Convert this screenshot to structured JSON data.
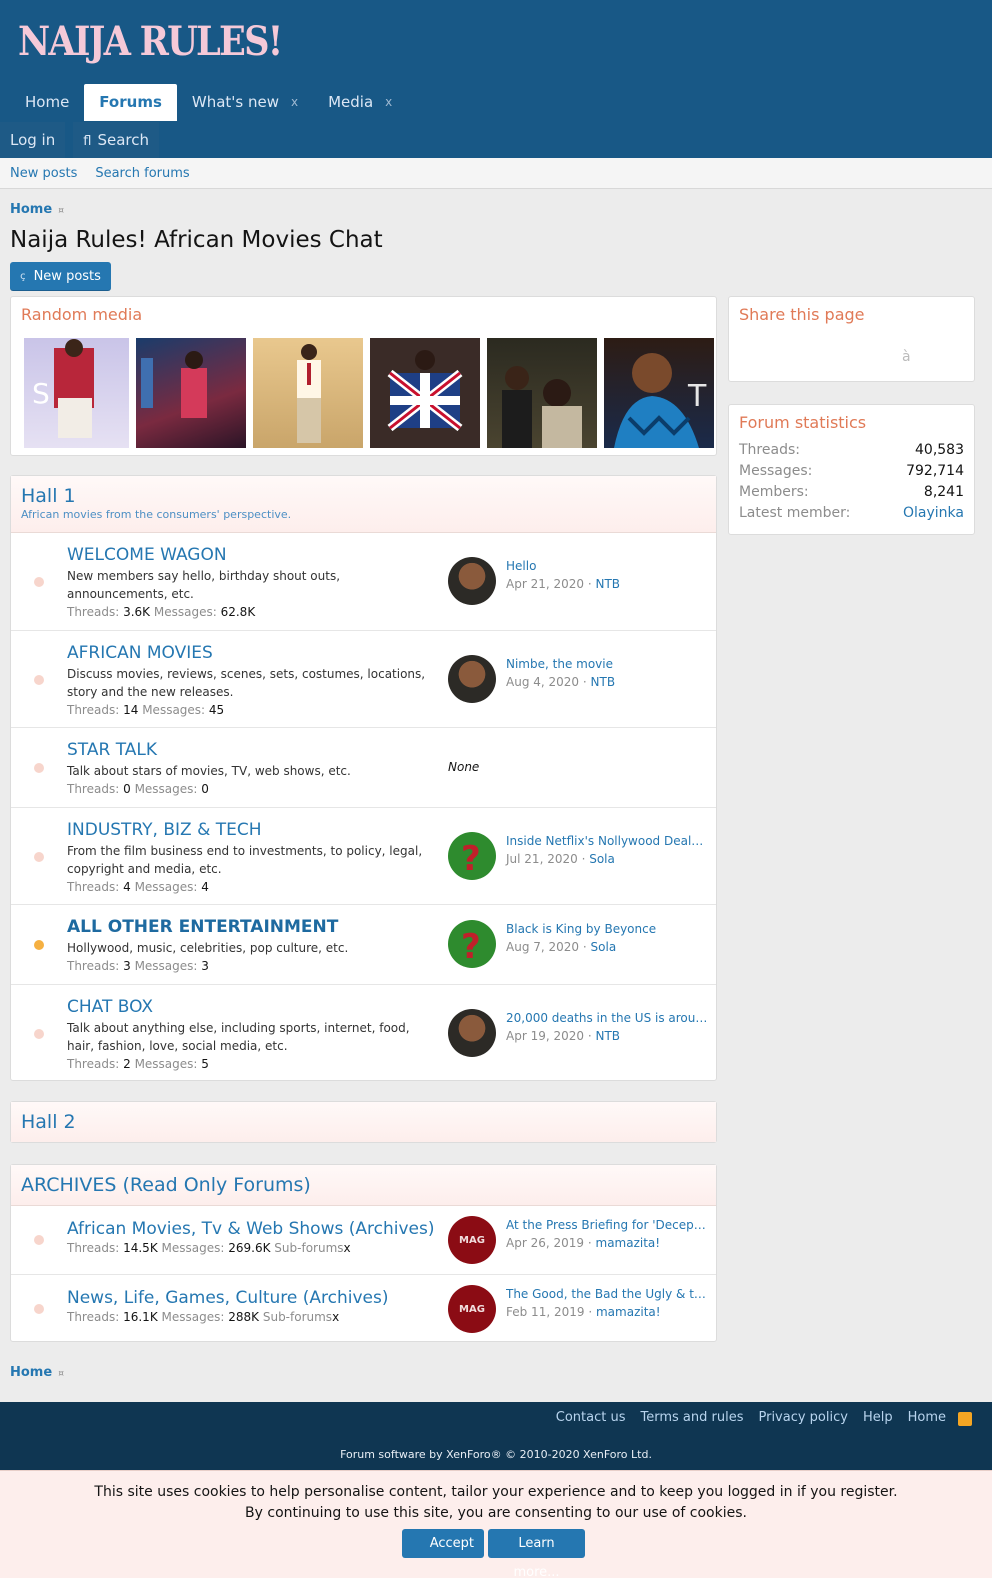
{
  "header": {
    "logo": "NAIJA RULES!",
    "nav": [
      {
        "label": "Home"
      },
      {
        "label": "Forums"
      },
      {
        "label": "What's new",
        "x": "x"
      },
      {
        "label": "Media",
        "x": "x"
      }
    ],
    "login_label": "Log in",
    "search_label": "Search",
    "search_glyph": "fl"
  },
  "subnav": {
    "new_posts": "New posts",
    "search_forums": "Search forums"
  },
  "breadcrumb": {
    "home": "Home",
    "sep": "¤"
  },
  "page": {
    "title": "Naija Rules! African Movies Chat",
    "new_posts_button": "New posts",
    "new_posts_glyph": "ç"
  },
  "random_media": {
    "title": "Random media"
  },
  "share": {
    "title": "Share this page",
    "glyph": "à"
  },
  "stats": {
    "title": "Forum statistics",
    "rows": [
      {
        "label": "Threads:",
        "value": "40,583"
      },
      {
        "label": "Messages:",
        "value": "792,714"
      },
      {
        "label": "Members:",
        "value": "8,241"
      },
      {
        "label": "Latest member:",
        "value": "Olayinka"
      }
    ]
  },
  "hall1": {
    "title": "Hall 1",
    "desc": "African movies from the consumers' perspective.",
    "nodes": [
      {
        "title": "WELCOME WAGON",
        "desc": "New members say hello, birthday shout outs, announcements, etc.",
        "threads": "3.6K",
        "messages": "62.8K",
        "last_title": "Hello",
        "last_date": "Apr 21, 2020",
        "last_user": "NTB"
      },
      {
        "title": "AFRICAN MOVIES",
        "desc": "Discuss movies, reviews, scenes, sets, costumes, locations, story and the new releases.",
        "threads": "14",
        "messages": "45",
        "last_title": "Nimbe, the movie",
        "last_date": "Aug 4, 2020",
        "last_user": "NTB"
      },
      {
        "title": "STAR TALK",
        "desc": "Talk about stars of movies, TV, web shows, etc.",
        "threads": "0",
        "messages": "0",
        "none": "None"
      },
      {
        "title": "INDUSTRY, BIZ & TECH",
        "desc": "From the film business end to investments, to policy, legal, copyright and media, etc.",
        "threads": "4",
        "messages": "4",
        "last_title": "Inside Netflix's Nollywood Deals ...",
        "last_date": "Jul 21, 2020",
        "last_user": "Sola"
      },
      {
        "title": "ALL OTHER ENTERTAINMENT",
        "desc": "Hollywood, music, celebrities, pop culture, etc.",
        "threads": "3",
        "messages": "3",
        "last_title": "Black is King by Beyonce",
        "last_date": "Aug 7, 2020",
        "last_user": "Sola"
      },
      {
        "title": "CHAT BOX",
        "desc": "Talk about anything else, including sports, internet, food, hair, fashion, love, social media, etc.",
        "threads": "2",
        "messages": "5",
        "last_title": "20,000 deaths in the US is aroun...",
        "last_date": "Apr 19, 2020",
        "last_user": "NTB"
      }
    ]
  },
  "hall2": {
    "title": "Hall 2"
  },
  "archives": {
    "title": "ARCHIVES (Read Only Forums)",
    "nodes": [
      {
        "title": "African Movies, Tv & Web Shows (Archives)",
        "threads": "14.5K",
        "messages": "269.6K",
        "subforums": "Sub-forums",
        "subforums_x": "x",
        "last_title": "At the Press Briefing for 'Decepti...",
        "last_date": "Apr 26, 2019",
        "last_user": "mamazita!",
        "avatar_text": "MAG"
      },
      {
        "title": "News, Life, Games, Culture (Archives)",
        "threads": "16.1K",
        "messages": "288K",
        "subforums": "Sub-forums",
        "subforums_x": "x",
        "last_title": "The Good, the Bad the Ugly & th...",
        "last_date": "Feb 11, 2019",
        "last_user": "mamazita!",
        "avatar_text": "MAG"
      }
    ]
  },
  "labels": {
    "threads": "Threads:",
    "messages": "Messages:",
    "dot": "·"
  },
  "footer": {
    "links": [
      "Contact us",
      "Terms and rules",
      "Privacy policy",
      "Help",
      "Home"
    ],
    "copyright": "Forum software by XenForo® © 2010-2020 XenForo Ltd."
  },
  "cookie": {
    "line1": "This site uses cookies to help personalise content, tailor your experience and to keep you logged in if you register.",
    "line2": "By continuing to use this site, you are consenting to our use of cookies.",
    "accept": "Accept",
    "learn_more": "Learn more..."
  },
  "colors": {
    "header": "#185886",
    "link": "#2577b1",
    "accent": "#e07a57",
    "unread": "#f5a623",
    "footer": "#0f3652"
  }
}
